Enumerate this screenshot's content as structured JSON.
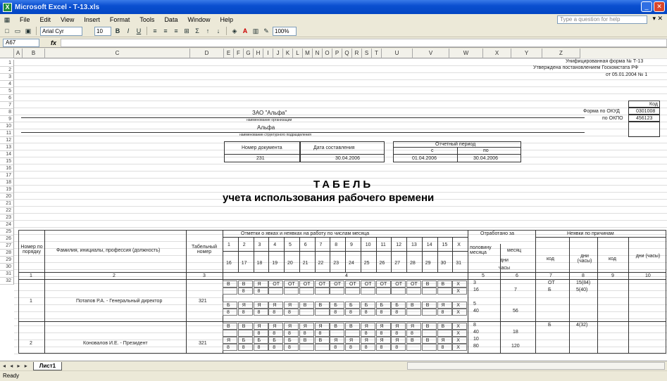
{
  "window": {
    "title": "Microsoft Excel - Т-13.xls",
    "app_icon": "X"
  },
  "menu": {
    "items": [
      "File",
      "Edit",
      "View",
      "Insert",
      "Format",
      "Tools",
      "Data",
      "Window",
      "Help"
    ],
    "help_placeholder": "Type a question for help",
    "close_doc": "▾ ✕"
  },
  "toolbar": {
    "font": "Arial Cyr",
    "size": "10",
    "zoom": "100%"
  },
  "formula_bar": {
    "name_box": "A67",
    "fx": "fx",
    "value": ""
  },
  "columns": [
    "A",
    "B",
    "C",
    "D",
    "E",
    "F",
    "G",
    "H",
    "I",
    "J",
    "K",
    "L",
    "M",
    "N",
    "O",
    "P",
    "Q",
    "R",
    "S",
    "T",
    "U",
    "V",
    "W",
    "X",
    "Y",
    "Z"
  ],
  "rows": [
    "1",
    "2",
    "3",
    "4",
    "5",
    "6",
    "7",
    "8",
    "9",
    "10",
    "11",
    "12",
    "13",
    "14",
    "15",
    "16",
    "17",
    "18",
    "19",
    "20",
    "21",
    "22",
    "23",
    "24",
    "25",
    "26",
    "27",
    "28",
    "29",
    "30",
    "31",
    "32"
  ],
  "sheet": {
    "form_line1": "Унифицированная форма № Т-13",
    "form_line2": "Утверждена постановлением Госкомстата РФ",
    "form_line3": "от 05.01.2004 № 1",
    "code_label": "Код",
    "okud_label": "Форма по ОКУД",
    "okud": "0301008",
    "okpo_label": "по ОКПО",
    "okpo": "456123",
    "org": "ЗАО \"Альфа\"",
    "org_caption": "наименование организации",
    "dept": "Альфа",
    "dept_caption": "наименование структурного подразделения",
    "doc_num_label": "Номер документа",
    "doc_date_label": "Дата составления",
    "period_label": "Отчетный период",
    "period_from_label": "с",
    "period_to_label": "по",
    "doc_num": "231",
    "doc_date": "30.04.2006",
    "period_from": "01.04.2006",
    "period_to": "30.04.2006",
    "title1": "ТАБЕЛЬ",
    "title2": "учета использования рабочего времени",
    "h_num": "Номер по порядку",
    "h_name": "Фамилия, инициалы, профессия (должность)",
    "h_tab": "Табельный номер",
    "h_marks": "Отметки о явках и неявках на работу по числам месяца",
    "h_worked": "Отработано за",
    "h_half": "половину месяца",
    "h_month": "месяц",
    "h_days": "дни",
    "h_hours": "часы",
    "h_absent": "Неявки по причинам",
    "h_code": "код",
    "h_dayshours": "дни (часы)",
    "days1": [
      "1",
      "2",
      "3",
      "4",
      "5",
      "6",
      "7",
      "8",
      "9",
      "10",
      "11",
      "12",
      "13",
      "14",
      "15",
      "X"
    ],
    "days2": [
      "16",
      "17",
      "18",
      "19",
      "20",
      "21",
      "22",
      "23",
      "24",
      "25",
      "26",
      "27",
      "28",
      "29",
      "30",
      "31"
    ],
    "colnums": [
      "1",
      "2",
      "3",
      "4",
      "5",
      "6",
      "7",
      "8",
      "9",
      "10"
    ],
    "emp1": {
      "num": "1",
      "name": "Потапов Р.А. - Генеральный директор",
      "tab": "321",
      "half1": "3",
      "half1h": "16",
      "half2": "5",
      "half2h": "40",
      "month_d": "7",
      "month_h": "56",
      "code1": "ОТ",
      "dh1": "15(84)",
      "code2": "Б",
      "dh2": "5(40)"
    },
    "emp2": {
      "num": "2",
      "name": "Коновалов И.Е. - Президент",
      "tab": "321",
      "half1": "8",
      "half1h": "40",
      "half2": "10",
      "half2h": "80",
      "month_d": "18",
      "month_h": "120",
      "code1": "Б",
      "dh1": "4(32)"
    },
    "emp1_r1": [
      "В",
      "В",
      "Я",
      "ОТ",
      "ОТ",
      "ОТ",
      "ОТ",
      "ОТ",
      "ОТ",
      "ОТ",
      "ОТ",
      "ОТ",
      "ОТ",
      "В",
      "В",
      "X"
    ],
    "emp1_r2": [
      "",
      "8",
      "8",
      "",
      "",
      "",
      "",
      "",
      "",
      "",
      "",
      "",
      "",
      "",
      "",
      "X"
    ],
    "emp1_r3": [
      "Б",
      "Я",
      "Я",
      "Я",
      "Я",
      "В",
      "В",
      "Б",
      "Б",
      "Б",
      "Б",
      "Б",
      "В",
      "В",
      "Я",
      "X"
    ],
    "emp1_r4": [
      "8",
      "8",
      "8",
      "8",
      "8",
      "",
      "",
      "8",
      "8",
      "8",
      "8",
      "8",
      "",
      "",
      "8",
      "X"
    ],
    "emp2_r1": [
      "В",
      "В",
      "Я",
      "Я",
      "Я",
      "Я",
      "Я",
      "В",
      "В",
      "Я",
      "Я",
      "Я",
      "Я",
      "В",
      "В",
      "X"
    ],
    "emp2_r2": [
      "",
      "",
      "8",
      "8",
      "8",
      "8",
      "8",
      "",
      "",
      "8",
      "8",
      "8",
      "8",
      "",
      "",
      "X"
    ],
    "emp2_r3": [
      "Я",
      "Б",
      "Б",
      "Б",
      "Б",
      "В",
      "В",
      "Я",
      "Я",
      "Я",
      "Я",
      "Я",
      "В",
      "В",
      "Я",
      "X"
    ],
    "emp2_r4": [
      "8",
      "8",
      "8",
      "8",
      "8",
      "",
      "",
      "8",
      "8",
      "8",
      "8",
      "8",
      "",
      "",
      "8",
      "X"
    ]
  },
  "tabs": {
    "nav": "◂ ◂ ▸ ▸",
    "sheet1": "Лист1"
  },
  "status": "Ready"
}
